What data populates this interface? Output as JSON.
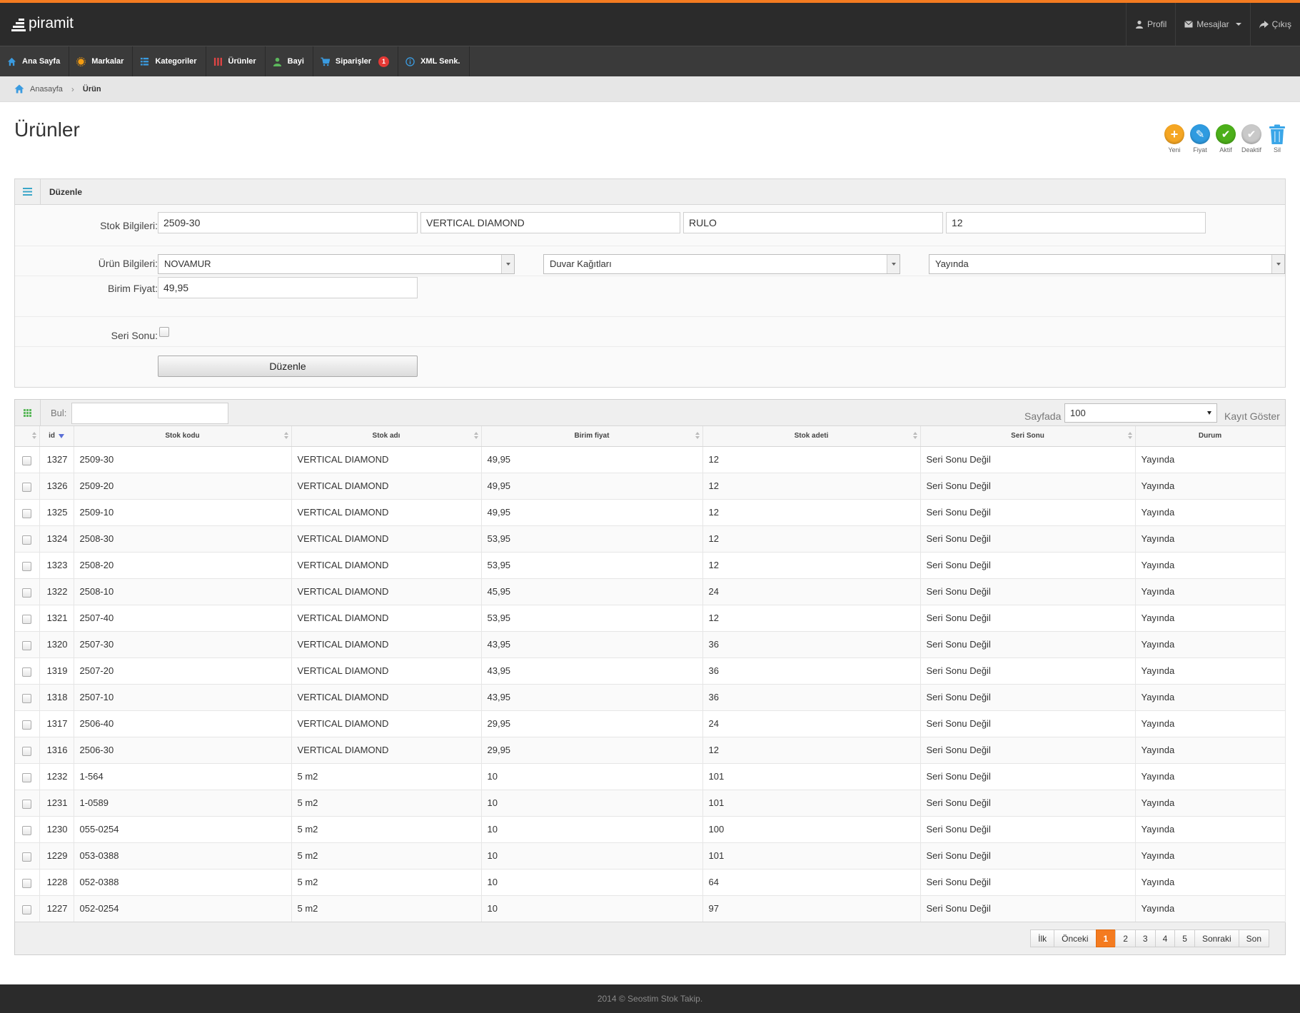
{
  "app": {
    "logo_text": "piramit"
  },
  "topnav": {
    "profile": "Profil",
    "messages": "Mesajlar",
    "logout": "Çıkış"
  },
  "mainnav": [
    {
      "label": "Ana Sayfa",
      "icon": "home-icon",
      "color": "#3a9be0"
    },
    {
      "label": "Markalar",
      "icon": "sun-icon",
      "color": "#f39c12"
    },
    {
      "label": "Kategoriler",
      "icon": "list-icon",
      "color": "#3a9be0"
    },
    {
      "label": "Ürünler",
      "icon": "columns-icon",
      "color": "#e04545"
    },
    {
      "label": "Bayi",
      "icon": "user-icon",
      "color": "#5cb85c"
    },
    {
      "label": "Siparişler",
      "icon": "cart-icon",
      "color": "#3a9be0",
      "badge": "1"
    },
    {
      "label": "XML Senk.",
      "icon": "info-icon",
      "color": "#3a9be0"
    }
  ],
  "breadcrumb": {
    "home": "Anasayfa",
    "current": "Ürün"
  },
  "page": {
    "title": "Ürünler"
  },
  "actions": [
    {
      "label": "Yeni",
      "icon": "plus-icon",
      "color": "#f5a623",
      "glyph": "+"
    },
    {
      "label": "Fiyat",
      "icon": "pencil-icon",
      "color": "#2f9be0",
      "glyph": "✎"
    },
    {
      "label": "Aktif",
      "icon": "check-icon",
      "color": "#4caf1a",
      "glyph": "✔"
    },
    {
      "label": "Deaktif",
      "icon": "check-gray-icon",
      "color": "#c9c9c9",
      "glyph": "✔"
    },
    {
      "label": "Sil",
      "icon": "trash-icon",
      "color": "#3aa6e8",
      "glyph": ""
    }
  ],
  "form": {
    "title": "Düzenle",
    "stock_label": "Stok Bilgileri:",
    "stock_code": "2509-30",
    "stock_name": "VERTICAL DIAMOND",
    "stock_unit": "RULO",
    "stock_qty": "12",
    "product_label": "Ürün Bilgileri:",
    "brand": "NOVAMUR",
    "category": "Duvar Kağıtları",
    "status": "Yayında",
    "price_label": "Birim Fiyat:",
    "price": "49,95",
    "series_end_label": "Seri Sonu:",
    "series_end_checked": false,
    "submit_label": "Düzenle"
  },
  "grid": {
    "search_label": "Bul:",
    "search_value": "",
    "per_page_label": "Sayfada",
    "per_page_value": "100",
    "per_page_suffix": "Kayıt Göster",
    "columns": [
      "id",
      "Stok kodu",
      "Stok adı",
      "Birim fiyat",
      "Stok adeti",
      "Seri Sonu",
      "Durum"
    ],
    "rows": [
      {
        "id": "1327",
        "code": "2509-30",
        "name": "VERTICAL DIAMOND",
        "price": "49,95",
        "qty": "12",
        "series": "Seri Sonu Değil",
        "status": "Yayında"
      },
      {
        "id": "1326",
        "code": "2509-20",
        "name": "VERTICAL DIAMOND",
        "price": "49,95",
        "qty": "12",
        "series": "Seri Sonu Değil",
        "status": "Yayında"
      },
      {
        "id": "1325",
        "code": "2509-10",
        "name": "VERTICAL DIAMOND",
        "price": "49,95",
        "qty": "12",
        "series": "Seri Sonu Değil",
        "status": "Yayında"
      },
      {
        "id": "1324",
        "code": "2508-30",
        "name": "VERTICAL DIAMOND",
        "price": "53,95",
        "qty": "12",
        "series": "Seri Sonu Değil",
        "status": "Yayında"
      },
      {
        "id": "1323",
        "code": "2508-20",
        "name": "VERTICAL DIAMOND",
        "price": "53,95",
        "qty": "12",
        "series": "Seri Sonu Değil",
        "status": "Yayında"
      },
      {
        "id": "1322",
        "code": "2508-10",
        "name": "VERTICAL DIAMOND",
        "price": "45,95",
        "qty": "24",
        "series": "Seri Sonu Değil",
        "status": "Yayında"
      },
      {
        "id": "1321",
        "code": "2507-40",
        "name": "VERTICAL DIAMOND",
        "price": "53,95",
        "qty": "12",
        "series": "Seri Sonu Değil",
        "status": "Yayında"
      },
      {
        "id": "1320",
        "code": "2507-30",
        "name": "VERTICAL DIAMOND",
        "price": "43,95",
        "qty": "36",
        "series": "Seri Sonu Değil",
        "status": "Yayında"
      },
      {
        "id": "1319",
        "code": "2507-20",
        "name": "VERTICAL DIAMOND",
        "price": "43,95",
        "qty": "36",
        "series": "Seri Sonu Değil",
        "status": "Yayında"
      },
      {
        "id": "1318",
        "code": "2507-10",
        "name": "VERTICAL DIAMOND",
        "price": "43,95",
        "qty": "36",
        "series": "Seri Sonu Değil",
        "status": "Yayında"
      },
      {
        "id": "1317",
        "code": "2506-40",
        "name": "VERTICAL DIAMOND",
        "price": "29,95",
        "qty": "24",
        "series": "Seri Sonu Değil",
        "status": "Yayında"
      },
      {
        "id": "1316",
        "code": "2506-30",
        "name": "VERTICAL DIAMOND",
        "price": "29,95",
        "qty": "12",
        "series": "Seri Sonu Değil",
        "status": "Yayında"
      },
      {
        "id": "1232",
        "code": "1-564",
        "name": "5 m2",
        "price": "10",
        "qty": "101",
        "series": "Seri Sonu Değil",
        "status": "Yayında"
      },
      {
        "id": "1231",
        "code": "1-0589",
        "name": "5 m2",
        "price": "10",
        "qty": "101",
        "series": "Seri Sonu Değil",
        "status": "Yayında"
      },
      {
        "id": "1230",
        "code": "055-0254",
        "name": "5 m2",
        "price": "10",
        "qty": "100",
        "series": "Seri Sonu Değil",
        "status": "Yayında"
      },
      {
        "id": "1229",
        "code": "053-0388",
        "name": "5 m2",
        "price": "10",
        "qty": "101",
        "series": "Seri Sonu Değil",
        "status": "Yayında"
      },
      {
        "id": "1228",
        "code": "052-0388",
        "name": "5 m2",
        "price": "10",
        "qty": "64",
        "series": "Seri Sonu Değil",
        "status": "Yayında"
      },
      {
        "id": "1227",
        "code": "052-0254",
        "name": "5 m2",
        "price": "10",
        "qty": "97",
        "series": "Seri Sonu Değil",
        "status": "Yayında"
      }
    ],
    "pager": {
      "first": "İlk",
      "prev": "Önceki",
      "pages": [
        "1",
        "2",
        "3",
        "4",
        "5"
      ],
      "active": "1",
      "next": "Sonraki",
      "last": "Son"
    }
  },
  "footer": {
    "text": "2014 © Seostim Stok Takip."
  },
  "colors": {
    "accent": "#f47b20",
    "topbar": "#2b2b2b",
    "nav": "#3a3a3a"
  }
}
